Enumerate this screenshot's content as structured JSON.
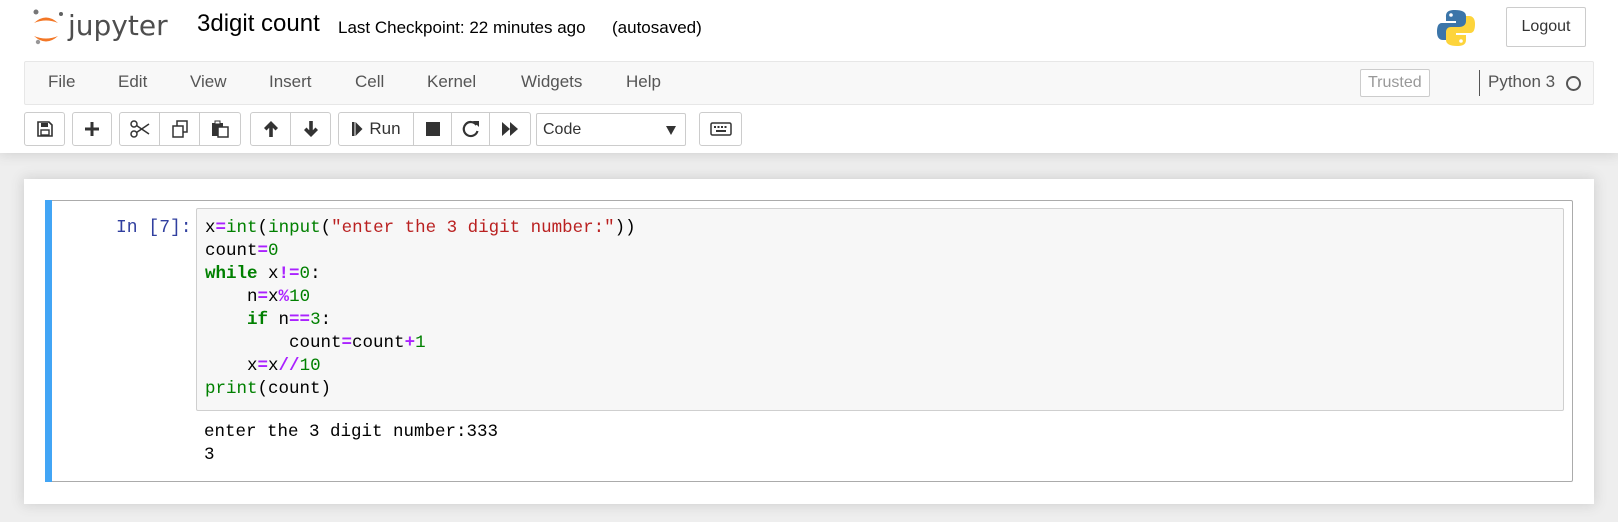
{
  "header": {
    "logo_text": "jupyter",
    "notebook_name": "3digit count",
    "checkpoint": "Last Checkpoint: 22 minutes ago",
    "autosave": "(autosaved)",
    "logout_label": "Logout",
    "kernel_logo_icon": "python-logo-icon"
  },
  "menubar": {
    "items": [
      "File",
      "Edit",
      "View",
      "Insert",
      "Cell",
      "Kernel",
      "Widgets",
      "Help"
    ],
    "trusted_label": "Trusted",
    "kernel_name": "Python 3"
  },
  "toolbar": {
    "icons": [
      "save-icon",
      "plus-icon",
      "cut-icon",
      "copy-icon",
      "paste-icon",
      "arrow-up-icon",
      "arrow-down-icon",
      "run-icon",
      "stop-icon",
      "restart-icon",
      "fast-forward-icon",
      "keyboard-icon"
    ],
    "run_label": "Run",
    "cell_type": "Code"
  },
  "cell": {
    "prompt": "In [7]:",
    "code_lines": [
      "x=int(input(\"enter the 3 digit number:\"))",
      "count=0",
      "while x!=0:",
      "    n=x%10",
      "    if n==3:",
      "        count=count+1",
      "    x=x//10",
      "print(count)"
    ],
    "output_lines": [
      "enter the 3 digit number:333",
      "3"
    ]
  },
  "colors": {
    "selected_cell_bar": "#42a5f5",
    "prompt": "#303f9f",
    "keyword": "#008000",
    "operator": "#aa22ff",
    "string": "#ba2121",
    "jupyter_orange": "#f37726"
  }
}
